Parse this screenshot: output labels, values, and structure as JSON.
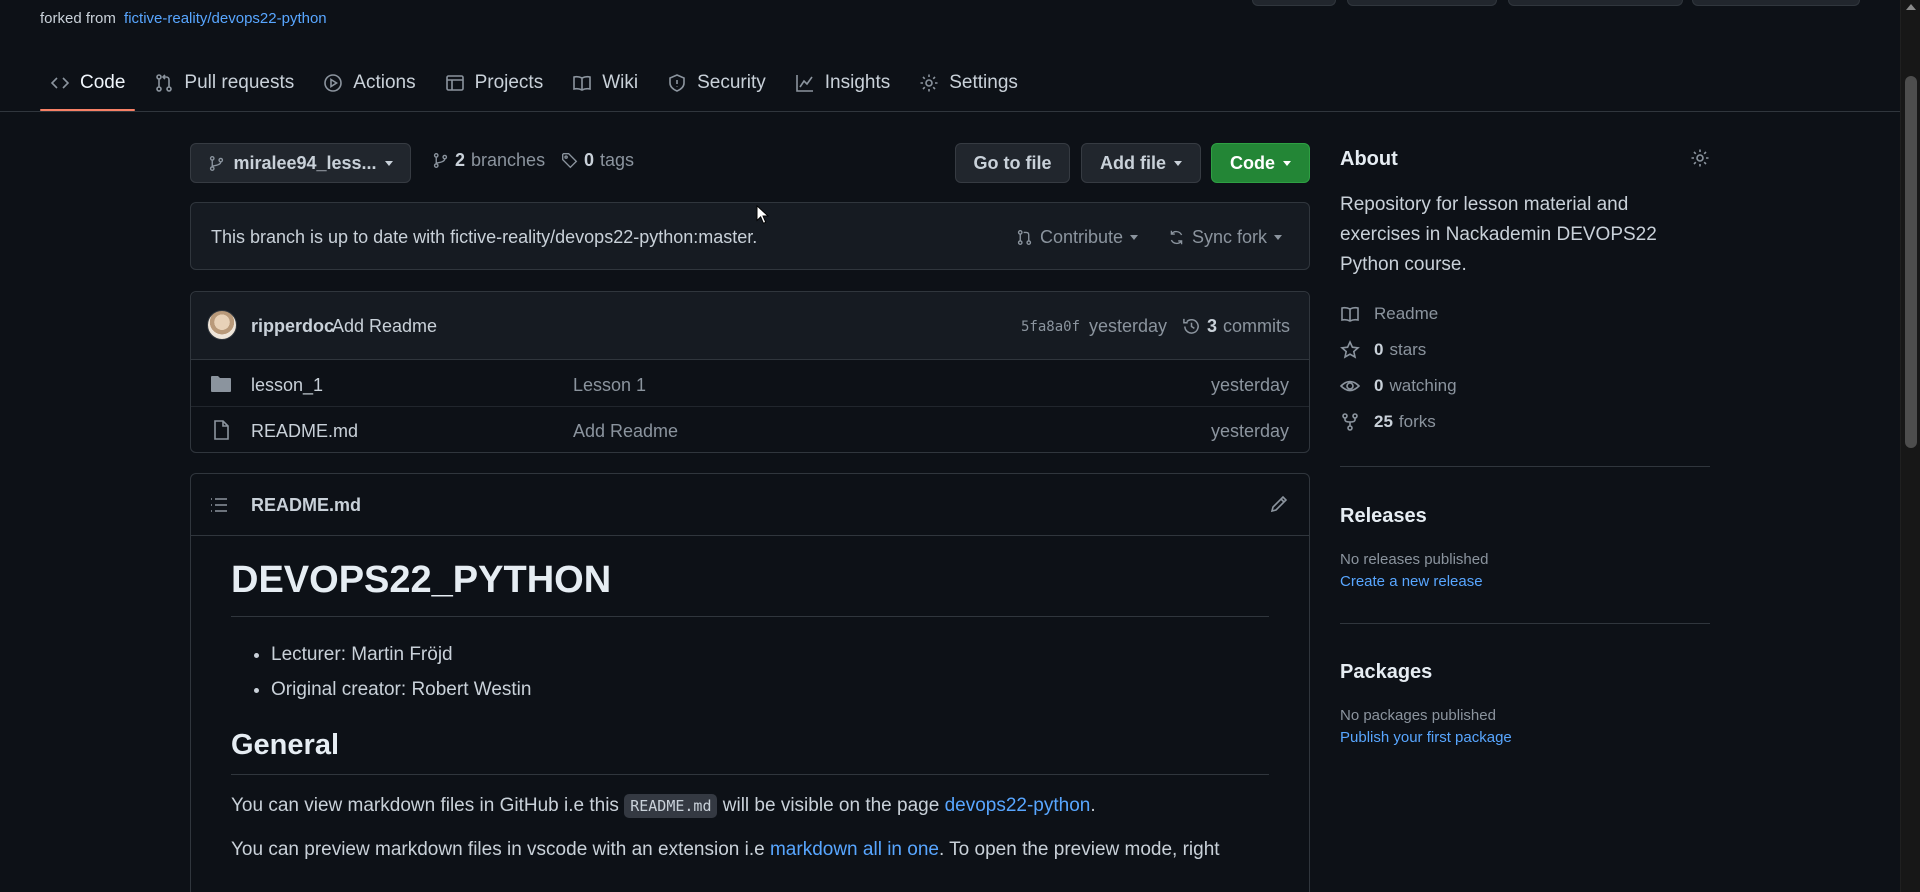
{
  "header": {
    "forked_prefix": "forked from",
    "forked_repo": "fictive-reality/devops22-python"
  },
  "tabs": [
    {
      "label": "Code",
      "icon": "code-icon",
      "active": true
    },
    {
      "label": "Pull requests",
      "icon": "pull-request-icon"
    },
    {
      "label": "Actions",
      "icon": "play-circle-icon"
    },
    {
      "label": "Projects",
      "icon": "table-icon"
    },
    {
      "label": "Wiki",
      "icon": "book-icon"
    },
    {
      "label": "Security",
      "icon": "shield-icon"
    },
    {
      "label": "Insights",
      "icon": "graph-icon"
    },
    {
      "label": "Settings",
      "icon": "gear-icon"
    }
  ],
  "toolbar": {
    "branch_label": "miralee94_less...",
    "branches_count": "2",
    "branches_label": "branches",
    "tags_count": "0",
    "tags_label": "tags",
    "go_to_file": "Go to file",
    "add_file": "Add file",
    "code": "Code"
  },
  "branch_status": {
    "message": "This branch is up to date with fictive-reality/devops22-python:master.",
    "contribute": "Contribute",
    "sync_fork": "Sync fork"
  },
  "latest_commit": {
    "author": "ripperdoc",
    "message": "Add Readme",
    "hash": "5fa8a0f",
    "time": "yesterday",
    "commits_count": "3",
    "commits_label": "commits"
  },
  "files": [
    {
      "name": "lesson_1",
      "type": "folder",
      "message": "Lesson 1",
      "time": "yesterday"
    },
    {
      "name": "README.md",
      "type": "file",
      "message": "Add Readme",
      "time": "yesterday"
    }
  ],
  "readme": {
    "filename": "README.md",
    "h1": "DEVOPS22_PYTHON",
    "bullets": [
      "Lecturer: Martin Fröjd",
      "Original creator: Robert Westin"
    ],
    "h2": "General",
    "p1_before": "You can view markdown files in GitHub i.e this ",
    "p1_code": "README.md",
    "p1_middle": " will be visible on the page ",
    "p1_link": "devops22-python",
    "p1_after": ".",
    "p2_before": "You can preview markdown files in vscode with an extension i.e ",
    "p2_link": "markdown all in one",
    "p2_after": ". To open the preview mode, right"
  },
  "about": {
    "title": "About",
    "description": "Repository for lesson material and exercises in Nackademin DEVOPS22 Python course.",
    "readme_label": "Readme",
    "stars_count": "0",
    "stars_label": "stars",
    "watching_count": "0",
    "watching_label": "watching",
    "forks_count": "25",
    "forks_label": "forks"
  },
  "releases": {
    "title": "Releases",
    "empty": "No releases published",
    "create_link": "Create a new release"
  },
  "packages": {
    "title": "Packages",
    "empty": "No packages published",
    "publish_link": "Publish your first package"
  },
  "colors": {
    "background": "#0d1117",
    "green_button": "#238636",
    "link": "#58a6ff",
    "active_tab_underline": "#f78166"
  }
}
